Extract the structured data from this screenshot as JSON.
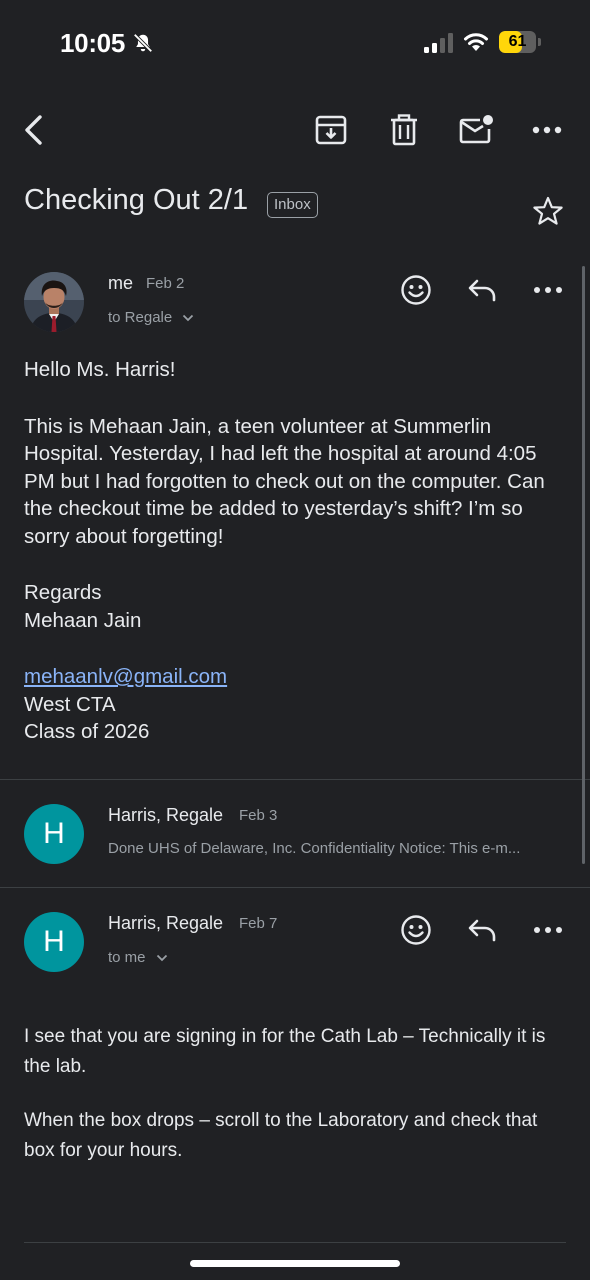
{
  "status_bar": {
    "time": "10:05",
    "battery": "61",
    "battery_percent": 61
  },
  "subject": {
    "title": "Checking Out 2/1",
    "label": "Inbox"
  },
  "messages": [
    {
      "sender": "me",
      "date": "Feb 2",
      "recipient": "to Regale",
      "body": {
        "greeting": "Hello Ms. Harris!",
        "paragraph": "This is Mehaan Jain, a teen volunteer at Summerlin Hospital. Yesterday, I had left the hospital at around 4:05 PM but I had forgotten to check out on the computer. Can the checkout time be added to yesterday’s shift? I’m so sorry about forgetting!",
        "closing": "Regards",
        "signature_name": "Mehaan Jain",
        "email": "mehaanlv@gmail.com",
        "school": "West CTA",
        "class_year": "Class of 2026"
      }
    },
    {
      "avatar_letter": "H",
      "sender": "Harris, Regale",
      "date": "Feb 3",
      "snippet": "Done UHS of Delaware, Inc. Confidentiality Notice: This e-m..."
    },
    {
      "avatar_letter": "H",
      "sender": "Harris, Regale",
      "date": "Feb 7",
      "recipient": "to me",
      "body": {
        "p1": "I see that you are signing in for the Cath Lab – Technically it is the lab.",
        "p2": "When the box drops – scroll to the Laboratory and check that box for your hours."
      }
    }
  ],
  "icons": [
    "bell-slash-icon",
    "cellular-signal-icon",
    "wifi-icon",
    "battery-icon",
    "back-arrow-icon",
    "archive-icon",
    "trash-icon",
    "mark-unread-icon",
    "more-icon",
    "star-icon",
    "emoji-react-icon",
    "reply-icon",
    "chevron-down-icon"
  ],
  "colors": {
    "background": "#202124",
    "avatar": "#00959e",
    "link": "#8ab4f8",
    "battery": "#ffd60a"
  }
}
